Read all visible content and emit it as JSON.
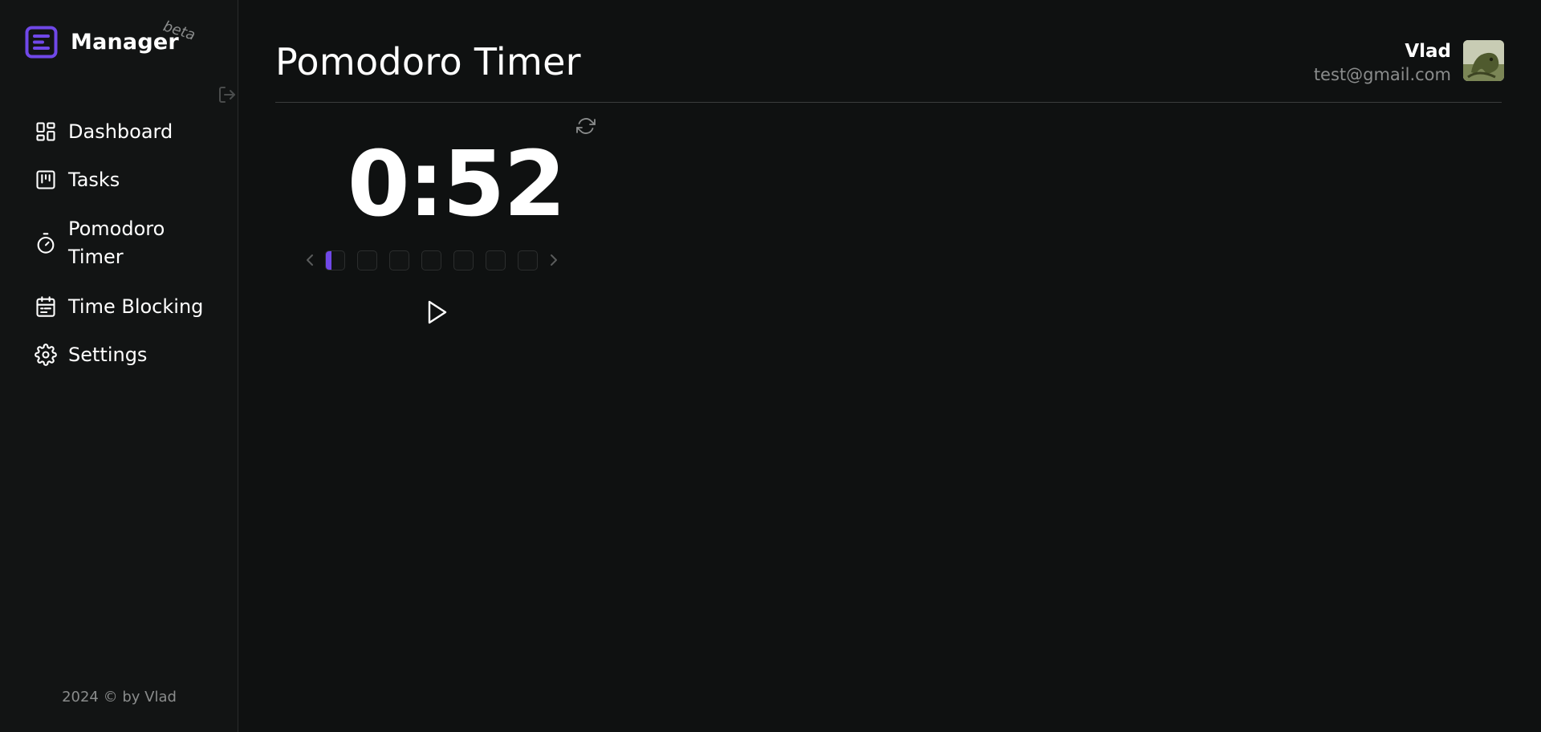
{
  "brand": {
    "name": "Manager",
    "badge": "beta",
    "accent_color": "#7048e8"
  },
  "sidebar": {
    "items": [
      {
        "label": "Dashboard",
        "icon": "dashboard-icon"
      },
      {
        "label": "Tasks",
        "icon": "kanban-icon"
      },
      {
        "label": "Pomodoro Timer",
        "icon": "stopwatch-icon"
      },
      {
        "label": "Time Blocking",
        "icon": "calendar-icon"
      },
      {
        "label": "Settings",
        "icon": "gear-icon"
      }
    ],
    "collapse_icon": "logout-icon",
    "footer": "2024 © by Vlad"
  },
  "header": {
    "title": "Pomodoro Timer",
    "user": {
      "name": "Vlad",
      "email": "test@gmail.com"
    }
  },
  "timer": {
    "display": "0:52",
    "rounds_total": 7,
    "current_round": 1,
    "current_round_progress": 0.3,
    "refresh_icon": "refresh-icon",
    "play_icon": "play-icon",
    "prev_icon": "chevron-left-icon",
    "next_icon": "chevron-right-icon"
  }
}
